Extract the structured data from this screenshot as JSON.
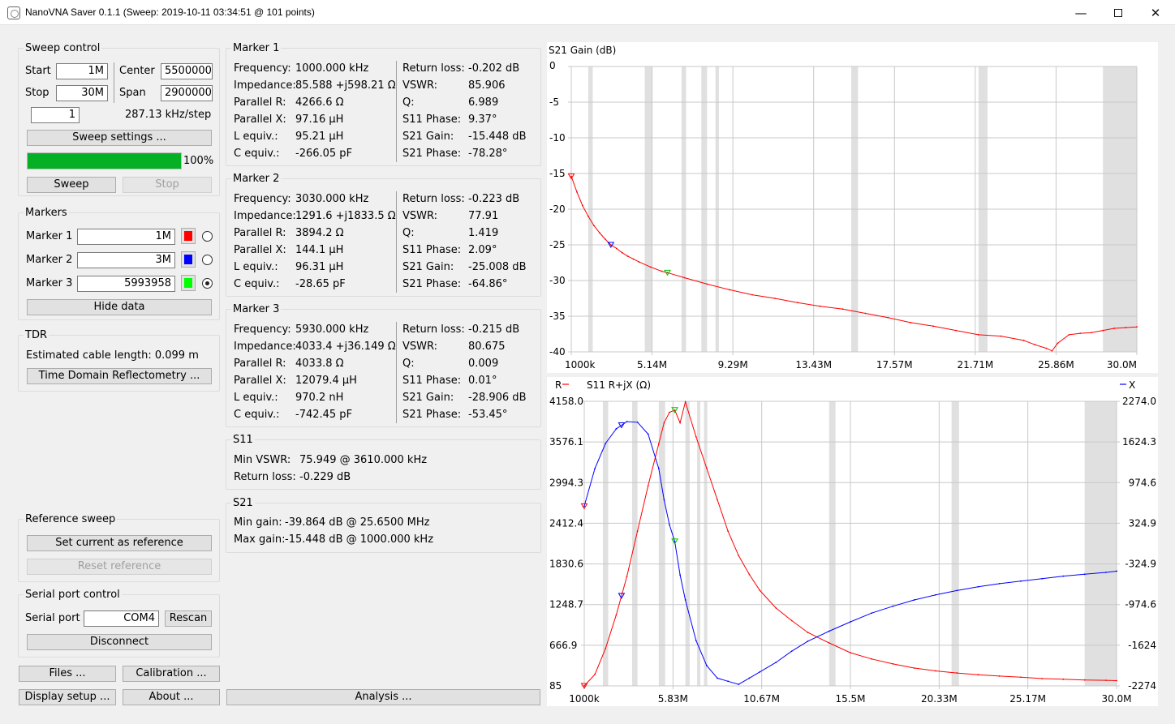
{
  "window": {
    "title": "NanoVNA Saver 0.1.1 (Sweep: 2019-10-11 03:34:51 @ 101 points)"
  },
  "sweep": {
    "title": "Sweep control",
    "start_label": "Start",
    "start_value": "1M",
    "center_label": "Center",
    "center_value": "5500000",
    "stop_label": "Stop",
    "stop_value": "30M",
    "span_label": "Span",
    "span_value": "29000000",
    "segments_value": "1",
    "step_text": "287.13 kHz/step",
    "settings_button": "Sweep settings ...",
    "progress": 100,
    "progress_text": "100%",
    "sweep_button": "Sweep",
    "stop_button": "Stop"
  },
  "markers": {
    "title": "Markers",
    "items": [
      {
        "label": "Marker 1",
        "value": "1M",
        "color": "#ff0000",
        "selected": false
      },
      {
        "label": "Marker 2",
        "value": "3M",
        "color": "#0000ff",
        "selected": false
      },
      {
        "label": "Marker 3",
        "value": "5993958",
        "color": "#00ff00",
        "selected": true
      }
    ],
    "hide_button": "Hide data"
  },
  "tdr": {
    "title": "TDR",
    "cable_text": "Estimated cable length: 0.099 m",
    "button": "Time Domain Reflectometry ..."
  },
  "reference": {
    "title": "Reference sweep",
    "set_button": "Set current as reference",
    "reset_button": "Reset reference"
  },
  "serial": {
    "title": "Serial port control",
    "port_label": "Serial port",
    "port_value": "COM4",
    "rescan_button": "Rescan",
    "disconnect_button": "Disconnect"
  },
  "bottom_buttons": {
    "files": "Files ...",
    "calibration": "Calibration ...",
    "display": "Display setup ...",
    "about": "About ...",
    "analysis": "Analysis ..."
  },
  "marker_details": [
    {
      "title": "Marker 1",
      "left": [
        [
          "Frequency:",
          "1000.000 kHz"
        ],
        [
          "Impedance:",
          "85.588 +j598.21 Ω"
        ],
        [
          "Parallel R:",
          "4266.6 Ω"
        ],
        [
          "Parallel X:",
          "97.16 μH"
        ],
        [
          "L equiv.:",
          "95.21 μH"
        ],
        [
          "C equiv.:",
          "-266.05 pF"
        ]
      ],
      "right": [
        [
          "Return loss:",
          "-0.202 dB"
        ],
        [
          "VSWR:",
          "85.906"
        ],
        [
          "Q:",
          "6.989"
        ],
        [
          "S11 Phase:",
          "9.37°"
        ],
        [
          "S21 Gain:",
          "-15.448 dB"
        ],
        [
          "S21 Phase:",
          "-78.28°"
        ]
      ]
    },
    {
      "title": "Marker 2",
      "left": [
        [
          "Frequency:",
          "3030.000 kHz"
        ],
        [
          "Impedance:",
          "1291.6 +j1833.5 Ω"
        ],
        [
          "Parallel R:",
          "3894.2 Ω"
        ],
        [
          "Parallel X:",
          "144.1 μH"
        ],
        [
          "L equiv.:",
          "96.31 μH"
        ],
        [
          "C equiv.:",
          "-28.65 pF"
        ]
      ],
      "right": [
        [
          "Return loss:",
          "-0.223 dB"
        ],
        [
          "VSWR:",
          "77.91"
        ],
        [
          "Q:",
          "1.419"
        ],
        [
          "S11 Phase:",
          "2.09°"
        ],
        [
          "S21 Gain:",
          "-25.008 dB"
        ],
        [
          "S21 Phase:",
          "-64.86°"
        ]
      ]
    },
    {
      "title": "Marker 3",
      "left": [
        [
          "Frequency:",
          "5930.000 kHz"
        ],
        [
          "Impedance:",
          "4033.4 +j36.149 Ω"
        ],
        [
          "Parallel R:",
          "4033.8 Ω"
        ],
        [
          "Parallel X:",
          "12079.4 μH"
        ],
        [
          "L equiv.:",
          "970.2 nH"
        ],
        [
          "C equiv.:",
          "-742.45 pF"
        ]
      ],
      "right": [
        [
          "Return loss:",
          "-0.215 dB"
        ],
        [
          "VSWR:",
          "80.675"
        ],
        [
          "Q:",
          "0.009"
        ],
        [
          "S11 Phase:",
          "0.01°"
        ],
        [
          "S21 Gain:",
          "-28.906 dB"
        ],
        [
          "S21 Phase:",
          "-53.45°"
        ]
      ]
    }
  ],
  "s11_summary": {
    "title": "S11",
    "min_vswr_label": "Min VSWR:",
    "min_vswr_value": "75.949 @ 3610.000 kHz",
    "return_loss_label": "Return loss:",
    "return_loss_value": "-0.229 dB"
  },
  "s21_summary": {
    "title": "S21",
    "min_gain_label": "Min gain:",
    "min_gain_value": "-39.864 dB @ 25.6500 MHz",
    "max_gain_label": "Max gain:",
    "max_gain_value": "-15.448 dB @ 1000.000 kHz"
  },
  "chart_data": [
    {
      "type": "line",
      "title": "S21 Gain (dB)",
      "x_unit": "MHz",
      "xlim": [
        1.0,
        30.0
      ],
      "ylim": [
        -40,
        0
      ],
      "x_tick_labels": [
        "1000k",
        "5.14M",
        "9.29M",
        "13.43M",
        "17.57M",
        "21.71M",
        "25.86M",
        "30.0M"
      ],
      "y_tick_labels": [
        "0",
        "-5",
        "-10",
        "-15",
        "-20",
        "-25",
        "-30",
        "-35",
        "-40"
      ],
      "grid": true,
      "series": [
        {
          "color": "#ff0000",
          "x": [
            1.0,
            1.29,
            1.58,
            1.87,
            2.16,
            2.45,
            2.74,
            3.03,
            3.32,
            3.61,
            3.9,
            4.19,
            4.48,
            5.06,
            5.64,
            5.93,
            6.8,
            7.96,
            9.12,
            10.28,
            11.44,
            12.6,
            13.76,
            14.92,
            16.08,
            17.24,
            18.4,
            19.56,
            20.72,
            21.88,
            23.04,
            24.2,
            24.78,
            25.36,
            25.65,
            25.94,
            26.52,
            27.1,
            27.68,
            28.26,
            28.84,
            29.42,
            30.0
          ],
          "y": [
            -15.4,
            -17.6,
            -19.5,
            -21.0,
            -22.3,
            -23.3,
            -24.2,
            -25.0,
            -25.5,
            -26.1,
            -26.6,
            -27.0,
            -27.4,
            -28.1,
            -28.7,
            -28.9,
            -29.6,
            -30.5,
            -31.3,
            -32.0,
            -32.5,
            -33.1,
            -33.6,
            -34.0,
            -34.6,
            -35.2,
            -35.9,
            -36.4,
            -37.0,
            -37.6,
            -37.8,
            -38.4,
            -39.0,
            -39.5,
            -39.86,
            -38.8,
            -37.6,
            -37.4,
            -37.3,
            -37.0,
            -36.7,
            -36.6,
            -36.5
          ]
        }
      ],
      "markers_x": [
        1.0,
        3.03,
        5.93
      ]
    },
    {
      "type": "line",
      "title": "S11 R+jX (Ω)",
      "left_label": "R",
      "right_label": "X",
      "x_unit": "MHz",
      "xlim": [
        1.0,
        30.0
      ],
      "ylim_left": [
        85,
        4158
      ],
      "ylim_right": [
        -2274,
        2274
      ],
      "x_tick_labels": [
        "1000k",
        "5.83M",
        "10.67M",
        "15.5M",
        "20.33M",
        "25.17M",
        "30.0M"
      ],
      "y_left_tick_labels": [
        "4158.0",
        "3576.1",
        "2994.3",
        "2412.4",
        "1830.6",
        "1248.7",
        "666.9",
        "85"
      ],
      "y_right_tick_labels": [
        "2274.0",
        "1624.3",
        "974.6",
        "324.9",
        "-324.9",
        "-974.6",
        "-1624",
        "-2274"
      ],
      "grid": true,
      "series": [
        {
          "name": "R",
          "color": "#ff0000",
          "x": [
            1.0,
            1.58,
            2.16,
            2.74,
            3.32,
            3.9,
            4.48,
            5.06,
            5.35,
            5.64,
            5.93,
            6.22,
            6.51,
            7.09,
            7.67,
            8.25,
            8.83,
            9.41,
            9.99,
            10.57,
            11.44,
            12.3,
            13.18,
            14.34,
            15.5,
            16.66,
            17.82,
            18.98,
            20.14,
            21.3,
            22.46,
            23.62,
            24.78,
            25.94,
            27.1,
            28.26,
            29.42,
            30.0
          ],
          "y": [
            85,
            250,
            620,
            1100,
            1650,
            2300,
            2950,
            3550,
            3850,
            4000,
            4033,
            3850,
            4150,
            3650,
            3200,
            2750,
            2300,
            1950,
            1680,
            1450,
            1200,
            1020,
            850,
            700,
            560,
            470,
            400,
            340,
            300,
            270,
            245,
            225,
            210,
            190,
            180,
            170,
            165,
            160
          ]
        },
        {
          "name": "X",
          "color": "#0000ff",
          "x": [
            1.0,
            1.58,
            2.16,
            2.74,
            3.32,
            3.9,
            4.48,
            5.06,
            5.35,
            5.64,
            5.93,
            6.22,
            6.51,
            7.09,
            7.67,
            8.25,
            8.83,
            9.41,
            9.99,
            10.57,
            11.44,
            12.3,
            13.18,
            14.34,
            15.5,
            16.66,
            17.82,
            18.98,
            20.14,
            21.3,
            22.46,
            23.62,
            24.78,
            25.94,
            27.1,
            28.26,
            29.42,
            30.0
          ],
          "y": [
            598,
            1200,
            1600,
            1834,
            1950,
            1940,
            1750,
            1200,
            700,
            300,
            36,
            -500,
            -900,
            -1550,
            -1950,
            -2150,
            -2200,
            -2250,
            -2150,
            -2050,
            -1900,
            -1720,
            -1560,
            -1400,
            -1250,
            -1110,
            -1000,
            -900,
            -820,
            -750,
            -690,
            -640,
            -600,
            -560,
            -520,
            -490,
            -460,
            -440
          ]
        }
      ],
      "markers_x": [
        1.0,
        3.03,
        5.93
      ]
    }
  ]
}
